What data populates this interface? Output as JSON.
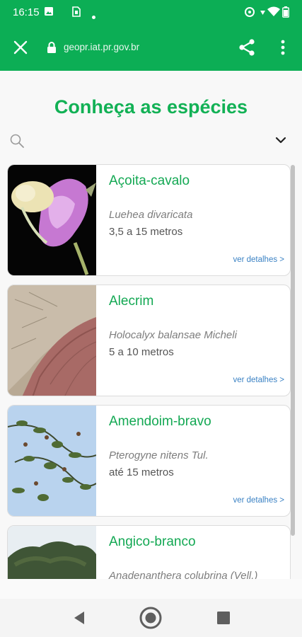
{
  "status_bar": {
    "time": "16:15",
    "left_icons": [
      "image-icon",
      "sim-card-icon",
      "dot-icon"
    ],
    "right_icons": [
      "data-saver-icon",
      "wifi-icon",
      "battery-icon"
    ]
  },
  "browser": {
    "url": "geopr.iat.pr.gov.br",
    "close_icon": "close-icon",
    "lock_icon": "lock-icon",
    "share_icon": "share-icon",
    "menu_icon": "more-vert-icon"
  },
  "page": {
    "title": "Conheça as espécies",
    "search": {
      "placeholder": "",
      "value": ""
    },
    "details_label": "ver detalhes >"
  },
  "species": [
    {
      "name": "Açoita-cavalo",
      "scientific": "Luehea divaricata",
      "height": "3,5 a 15 metros"
    },
    {
      "name": "Alecrim",
      "scientific": "Holocalyx balansae Micheli",
      "height": "5 a 10 metros"
    },
    {
      "name": "Amendoim-bravo",
      "scientific": "Pterogyne nitens Tul.",
      "height": "até 15 metros"
    },
    {
      "name": "Angico-branco",
      "scientific": "Anadenanthera colubrina (Vell.)",
      "height": ""
    }
  ],
  "colors": {
    "brand_green": "#0cae55",
    "title_green": "#12b155",
    "link_blue": "#3b82c4"
  }
}
